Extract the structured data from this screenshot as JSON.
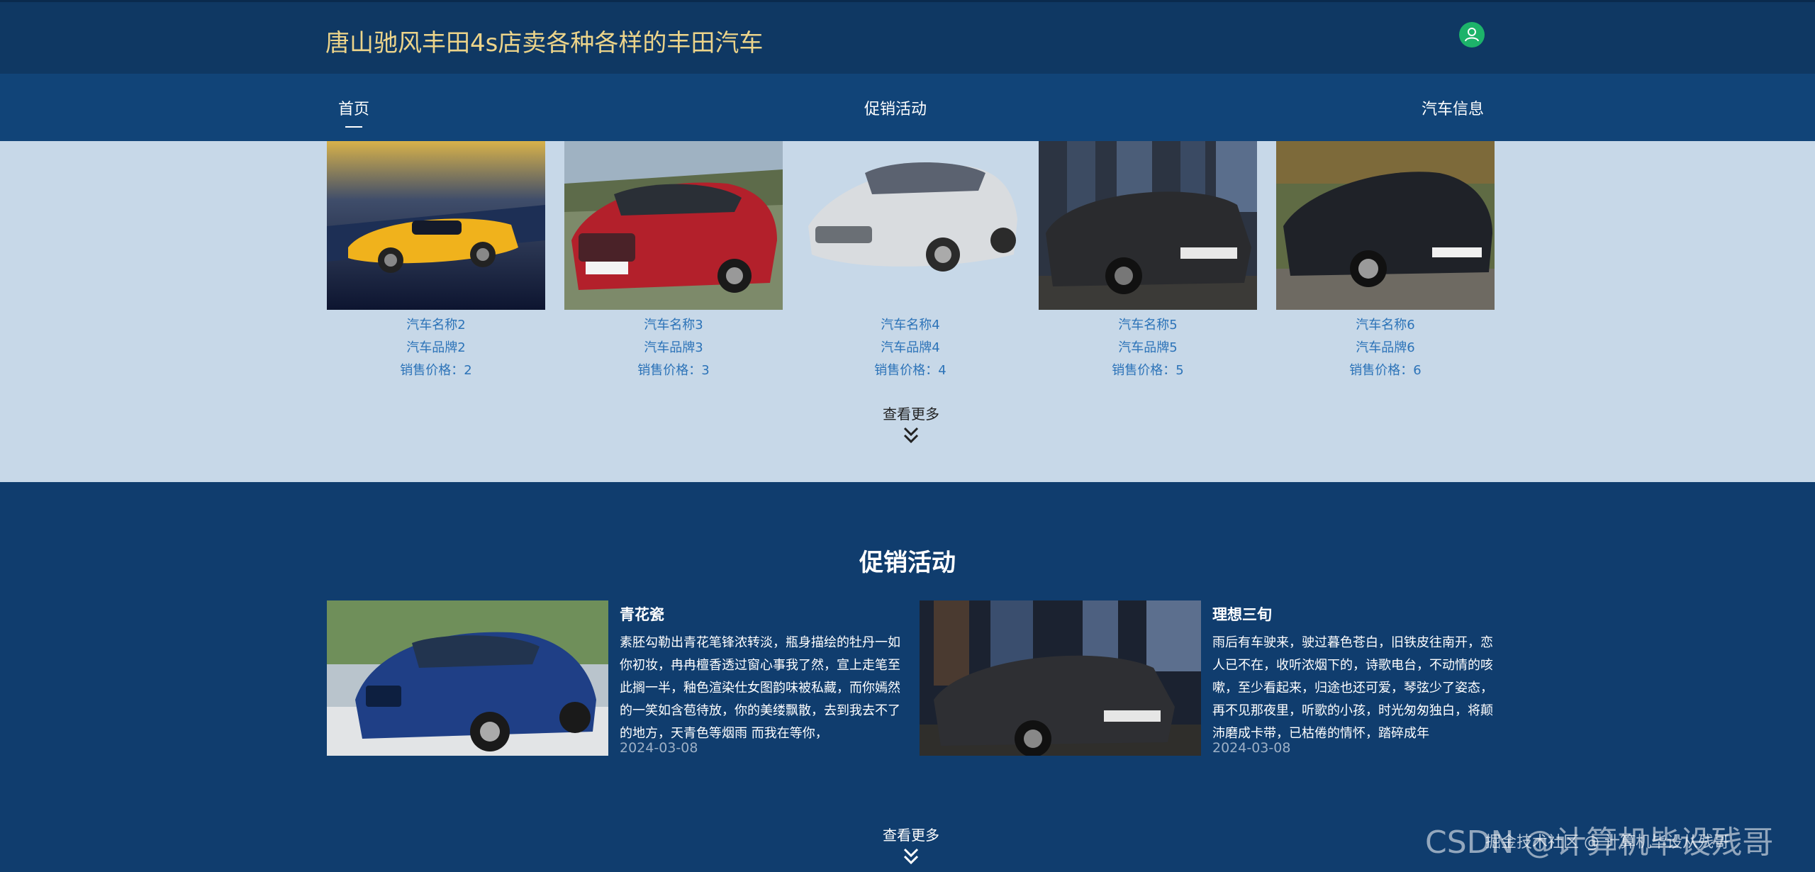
{
  "header": {
    "title": "唐山驰风丰田4s店卖各种各样的丰田汽车",
    "user_icon": "user-icon",
    "accent_color": "#ecd48a"
  },
  "nav": {
    "items": [
      {
        "label": "首页",
        "active": true
      },
      {
        "label": "促销活动",
        "active": false
      },
      {
        "label": "汽车信息",
        "active": false
      }
    ]
  },
  "cars": [
    {
      "name": "汽车名称2",
      "brand": "汽车品牌2",
      "price": "销售价格：2"
    },
    {
      "name": "汽车名称3",
      "brand": "汽车品牌3",
      "price": "销售价格：3"
    },
    {
      "name": "汽车名称4",
      "brand": "汽车品牌4",
      "price": "销售价格：4"
    },
    {
      "name": "汽车名称5",
      "brand": "汽车品牌5",
      "price": "销售价格：5"
    },
    {
      "name": "汽车名称6",
      "brand": "汽车品牌6",
      "price": "销售价格：6"
    }
  ],
  "cars_more": "查看更多",
  "promo": {
    "title": "促销活动",
    "more": "查看更多",
    "items": [
      {
        "name": "青花瓷",
        "desc": "素胚勾勒出青花笔锋浓转淡，瓶身描绘的牡丹一如你初妆，冉冉檀香透过窗心事我了然，宣上走笔至此搁一半，釉色渲染仕女图韵味被私藏，而你嫣然的一笑如含苞待放，你的美缕飘散，去到我去不了的地方，天青色等烟雨 而我在等你，",
        "date": "2024-03-08"
      },
      {
        "name": "理想三旬",
        "desc": "雨后有车驶来，驶过暮色苍白，旧铁皮往南开，恋人已不在，收听浓烟下的，诗歌电台，不动情的咳嗽，至少看起来，归途也还可爱，琴弦少了姿态，再不见那夜里，听歌的小孩，时光匆匆独白，将颠沛磨成卡带，已枯倦的情怀，踏碎成年",
        "date": "2024-03-08"
      }
    ]
  },
  "watermark": {
    "main": "CSDN @计算机毕设残哥",
    "sub": "掘金技术社区 @ 计算机毕设从残哥"
  }
}
